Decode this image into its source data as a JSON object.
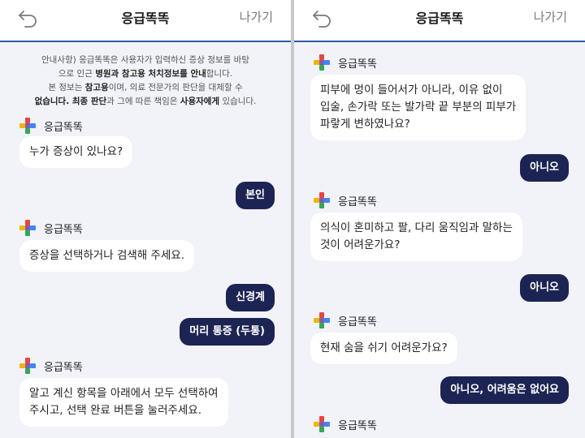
{
  "header": {
    "title": "응급똑똑",
    "exit_label": "나가기"
  },
  "notice": {
    "line1": "안내사항) 응급똑똑은 사용자가 입력하신 증상 정보를 바탕",
    "line2_pre": "으로 인근 ",
    "line2_bold": "병원과 참고용 처치정보를 안내",
    "line2_post": "합니다.",
    "line3_pre": "본 정보는 ",
    "line3_bold": "참고용",
    "line3_post": "이며, 의료 전문가의 판단을 대체할 수",
    "line4_bold1": "없습니다. 최종 판단",
    "line4_mid": "과 그에 따른 책임은 ",
    "line4_bold2": "사용자에게",
    "line4_post": " 있습니다."
  },
  "bot_name": "응급똑똑",
  "left_chat": {
    "q1": "누가 증상이 있나요?",
    "a1": "본인",
    "q2": "증상을 선택하거나 검색해 주세요.",
    "a2a": "신경계",
    "a2b": "머리 통증 (두통)",
    "q3_line1": "알고 계신 항목을 아래에서 모두 선택하여",
    "q3_line2": "주시고, 선택 완료 버튼을 눌러주세요."
  },
  "right_chat": {
    "q1_line1": "피부에 멍이 들어서가 아니라, 이유 없이",
    "q1_line2": "입술, 손가락 또는 발가락 끝 부분의 피부가",
    "q1_line3": "파랗게 변하였나요?",
    "a1": "아니오",
    "q2_line1": "의식이 혼미하고 팔, 다리 움직임과 말하는",
    "q2_line2": "것이 어려운가요?",
    "a2": "아니오",
    "q3": "현재 숨을 쉬기 어려운가요?",
    "a3": "아니오, 어려움은 없어요"
  },
  "colors": {
    "header_border": "#2f5aa8",
    "user_bubble": "#1c2453",
    "background": "#f1f3f8",
    "logo_red": "#e8453c",
    "logo_yellow": "#f5b400",
    "logo_green": "#34a853",
    "logo_blue": "#4285f4"
  },
  "icons": {
    "back": "back-arrow-icon",
    "logo": "medical-cross-logo-icon"
  }
}
